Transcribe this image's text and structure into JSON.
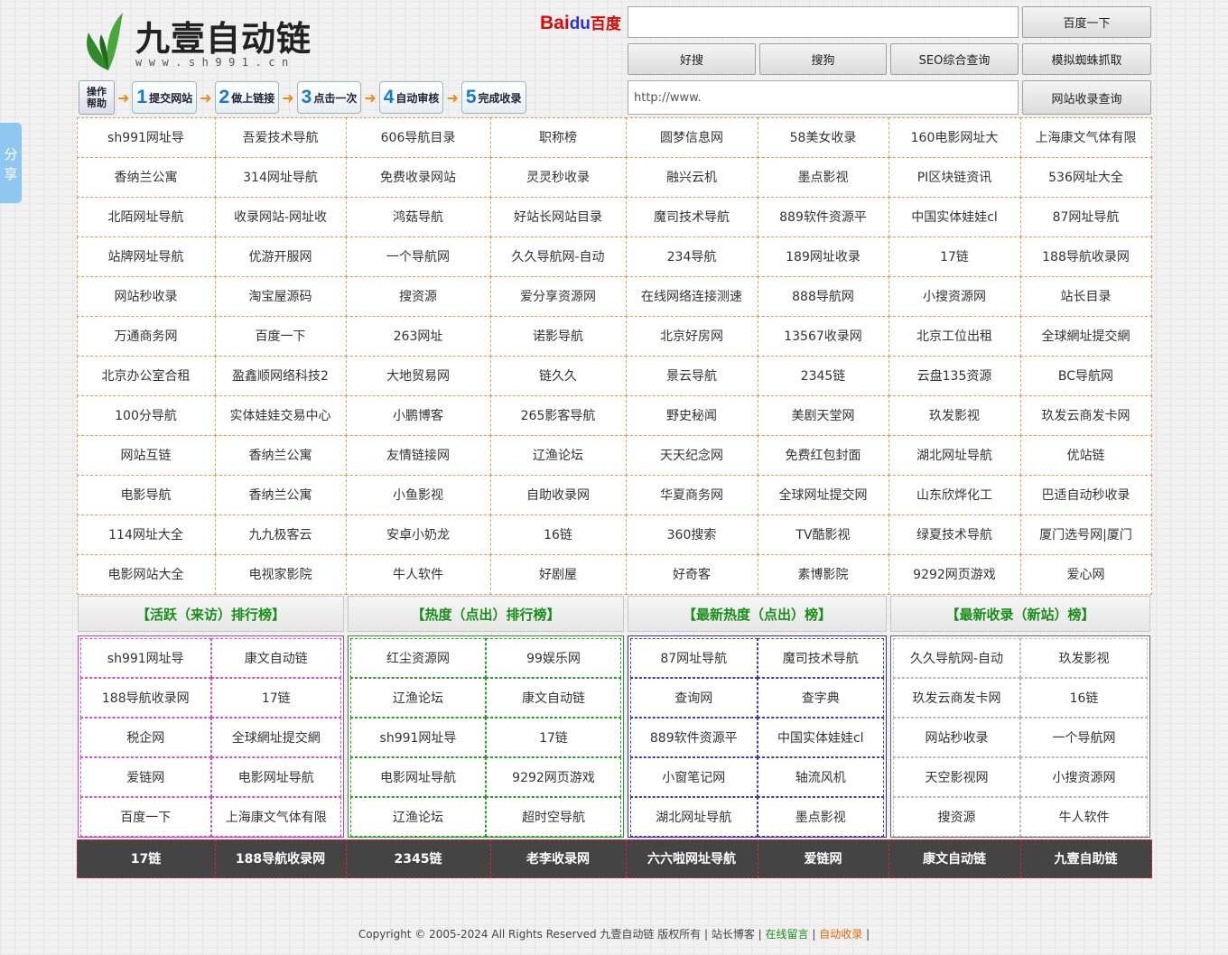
{
  "share_label": "分享",
  "logo": {
    "title": "九壹自动链",
    "url": "www.sh991.cn"
  },
  "search": {
    "brand_left": "Bai",
    "brand_paw": "du",
    "brand_cn": "百度",
    "query_value": "",
    "search_button": "百度一下",
    "buttons": [
      "好搜",
      "搜狗",
      "SEO综合查询",
      "模拟蜘蛛抓取"
    ],
    "url_value": "http://www.",
    "url_button": "网站收录查询"
  },
  "steps": {
    "help": "操作帮助",
    "items": [
      {
        "num": "1",
        "label": "提交网站"
      },
      {
        "num": "2",
        "label": "做上链接"
      },
      {
        "num": "3",
        "label": "点击一次"
      },
      {
        "num": "4",
        "label": "自动审核"
      },
      {
        "num": "5",
        "label": "完成收录"
      }
    ]
  },
  "grid": [
    [
      "sh991网址导",
      "吾爱技术导航",
      "606导航目录",
      "职称榜",
      "圆梦信息网",
      "58美女收录",
      "160电影网址大",
      "上海康文气体有限"
    ],
    [
      "香纳兰公寓",
      "314网址导航",
      "免费收录网站",
      "灵灵秒收录",
      "融兴云机",
      "墨点影视",
      "PI区块链资讯",
      "536网址大全"
    ],
    [
      "北陌网址导航",
      "收录网站-网址收",
      "鸿菇导航",
      "好站长网站目录",
      "魔司技术导航",
      "889软件资源平",
      "中国实体娃娃cl",
      "87网址导航"
    ],
    [
      "站牌网址导航",
      "优游开服网",
      "一个导航网",
      "久久导航网-自动",
      "234导航",
      "189网址收录",
      "17链",
      "188导航收录网"
    ],
    [
      "网站秒收录",
      "淘宝屋源码",
      "搜资源",
      "爱分享资源网",
      "在线网络连接测速",
      "888导航网",
      "小搜资源网",
      "站长目录"
    ],
    [
      "万通商务网",
      "百度一下",
      "263网址",
      "诺影导航",
      "北京好房网",
      "13567收录网",
      "北京工位出租",
      "全球網址提交網"
    ],
    [
      "北京办公室合租",
      "盈鑫顺网络科技2",
      "大地贸易网",
      "链久久",
      "景云导航",
      "2345链",
      "云盘135资源",
      "BC导航网"
    ],
    [
      "100分导航",
      "实体娃娃交易中心",
      "小鹏博客",
      "265影客导航",
      "野史秘闻",
      "美剧天堂网",
      "玖发影视",
      "玖发云商发卡网"
    ],
    [
      "网站互链",
      "香纳兰公寓",
      "友情链接网",
      "辽渔论坛",
      "天天纪念网",
      "免费红包封面",
      "湖北网址导航",
      "优站链"
    ],
    [
      "电影导航",
      "香纳兰公寓",
      "小鱼影视",
      "自助收录网",
      "华夏商务网",
      "全球网址提交网",
      "山东欣烨化工",
      "巴适自动秒收录"
    ],
    [
      "114网址大全",
      "九九极客云",
      "安卓小奶龙",
      "16链",
      "360搜索",
      "TV酷影视",
      "绿夏技术导航",
      "厦门选号网|厦门"
    ],
    [
      "电影网站大全",
      "电视家影院",
      "牛人软件",
      "好剧屋",
      "好奇客",
      "素博影院",
      "9292网页游戏",
      "爱心网"
    ]
  ],
  "rankings": [
    {
      "title": "【活跃（来访）排行榜】",
      "items": [
        "sh991网址导",
        "康文自动链",
        "188导航收录网",
        "17链",
        "税企网",
        "全球網址提交網",
        "爱链网",
        "电影网址导航",
        "百度一下",
        "上海康文气体有限"
      ]
    },
    {
      "title": "【热度（点出）排行榜】",
      "items": [
        "红尘资源网",
        "99娱乐网",
        "辽渔论坛",
        "康文自动链",
        "sh991网址导",
        "17链",
        "电影网址导航",
        "9292网页游戏",
        "辽渔论坛",
        "超时空导航"
      ]
    },
    {
      "title": "【最新热度（点出）榜】",
      "items": [
        "87网址导航",
        "魔司技术导航",
        "查询网",
        "查字典",
        "889软件资源平",
        "中国实体娃娃cl",
        "小窗笔记网",
        "轴流风机",
        "湖北网址导航",
        "墨点影视"
      ]
    },
    {
      "title": "【最新收录（新站）榜】",
      "items": [
        "久久导航网-自动",
        "玖发影视",
        "玖发云商发卡网",
        "16链",
        "网站秒收录",
        "一个导航网",
        "天空影视网",
        "小搜资源网",
        "搜资源",
        "牛人软件"
      ]
    }
  ],
  "bottom_links": [
    "17链",
    "188导航收录网",
    "2345链",
    "老李收录网",
    "六六啦网址导航",
    "爱链网",
    "康文自动链",
    "九壹自助链"
  ],
  "footer": {
    "copyright": "Copyright © 2005-2024 All Rights Reserved 九壹自动链 版权所有 | 站长博客 | ",
    "link1": "在线留言",
    "sep": " | ",
    "link2": "自动收录",
    "tail": " |"
  }
}
